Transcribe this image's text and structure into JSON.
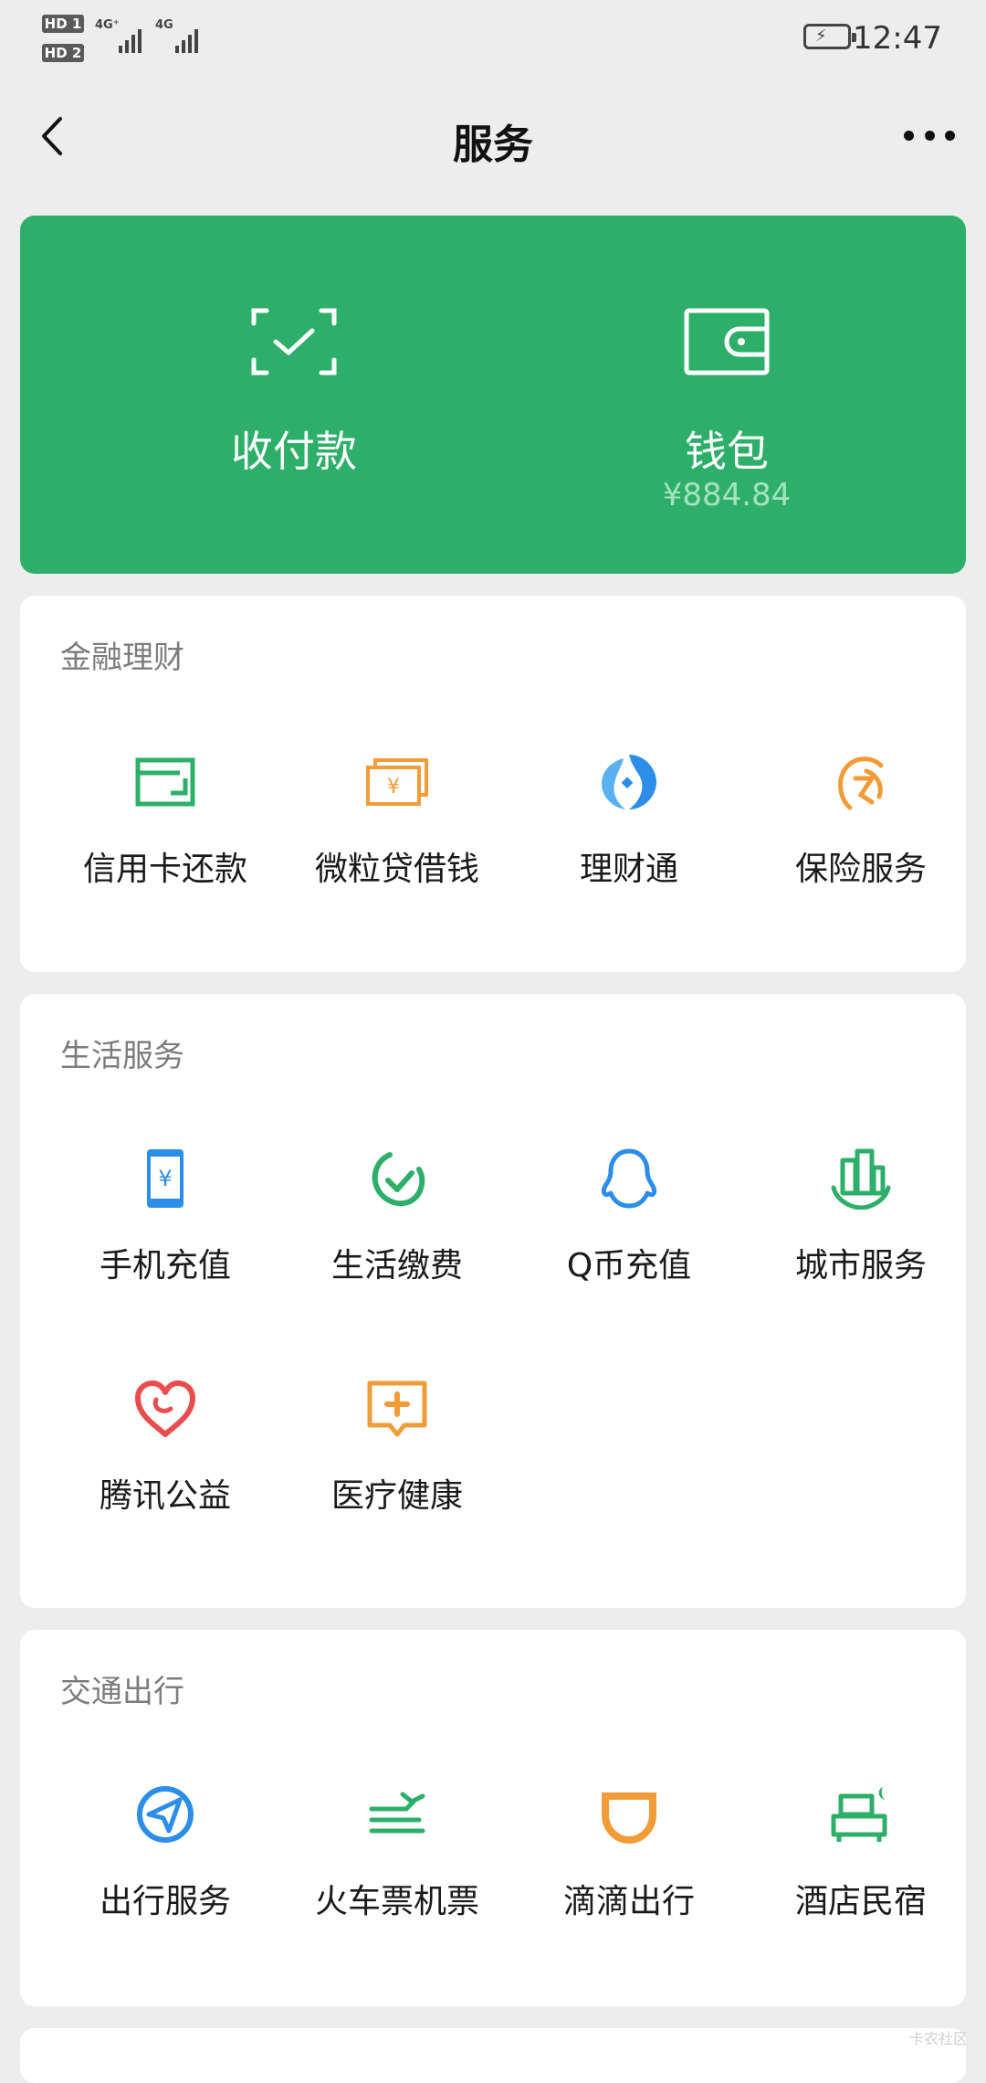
{
  "status_bar": {
    "sim1_label": "HD 1",
    "sim2_label": "HD 2",
    "net1": "4G⁺",
    "net2": "4G",
    "time": "12:47"
  },
  "nav": {
    "title": "服务",
    "back_icon": "chevron-left-icon",
    "more_icon": "more-dots-icon"
  },
  "top_card": {
    "color": "#2daf6a",
    "pay": {
      "label": "收付款",
      "icon": "scan-qr-icon"
    },
    "wallet": {
      "label": "钱包",
      "balance": "¥884.84",
      "icon": "wallet-icon"
    }
  },
  "sections": [
    {
      "title": "金融理财",
      "items": [
        {
          "label": "信用卡还款",
          "icon": "credit-card-icon",
          "color": "#2daf6a"
        },
        {
          "label": "微粒贷借钱",
          "icon": "cash-icon",
          "color": "#f29c38"
        },
        {
          "label": "理财通",
          "icon": "wealth-icon",
          "color": "#2c8ee8"
        },
        {
          "label": "保险服务",
          "icon": "insurance-icon",
          "color": "#f29c38"
        }
      ]
    },
    {
      "title": "生活服务",
      "items": [
        {
          "label": "手机充值",
          "icon": "phone-topup-icon",
          "color": "#2c8ee8"
        },
        {
          "label": "生活缴费",
          "icon": "utility-payment-icon",
          "color": "#2daf6a"
        },
        {
          "label": "Q币充值",
          "icon": "qq-penguin-icon",
          "color": "#2c8ee8"
        },
        {
          "label": "城市服务",
          "icon": "city-icon",
          "color": "#2daf6a"
        },
        {
          "label": "腾讯公益",
          "icon": "charity-heart-icon",
          "color": "#e94d4d"
        },
        {
          "label": "医疗健康",
          "icon": "medical-icon",
          "color": "#f29c38"
        }
      ]
    },
    {
      "title": "交通出行",
      "items": [
        {
          "label": "出行服务",
          "icon": "navigation-icon",
          "color": "#2c8ee8"
        },
        {
          "label": "火车票机票",
          "icon": "train-plane-icon",
          "color": "#2daf6a"
        },
        {
          "label": "滴滴出行",
          "icon": "didi-icon",
          "color": "#f29c38"
        },
        {
          "label": "酒店民宿",
          "icon": "hotel-bed-icon",
          "color": "#2daf6a"
        }
      ]
    }
  ],
  "watermark": "卡农社区"
}
